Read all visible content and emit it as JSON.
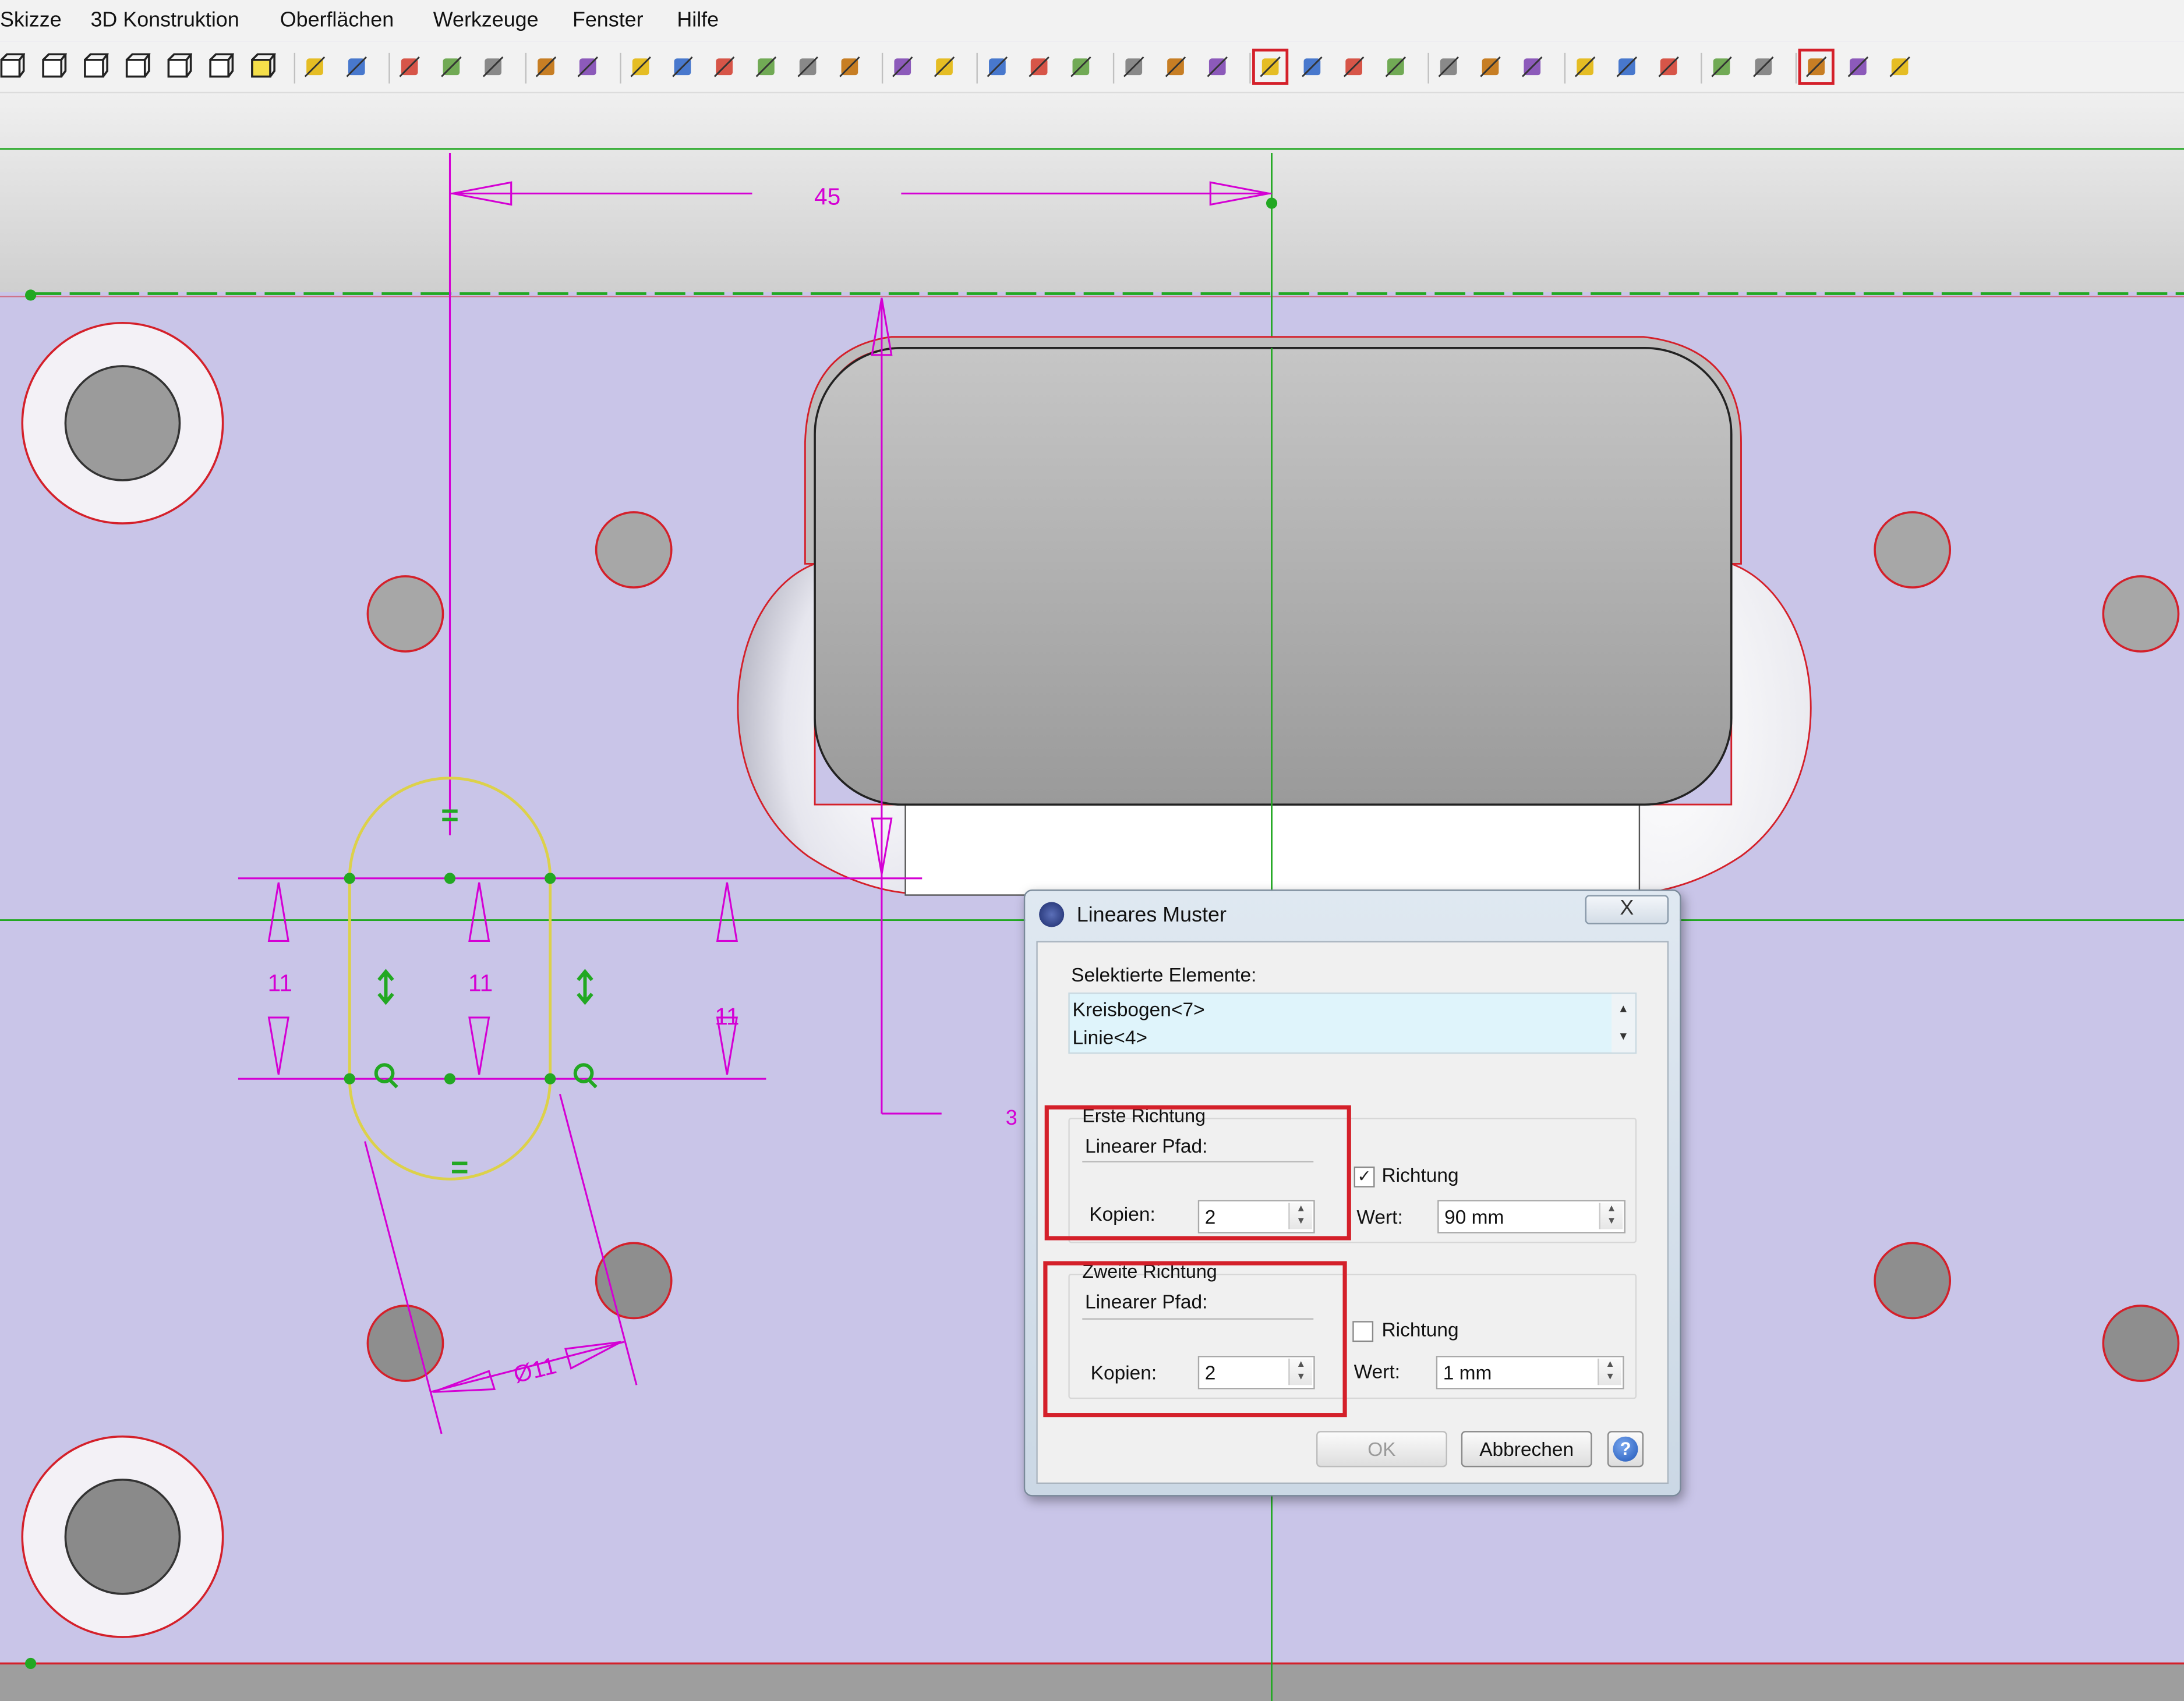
{
  "menu": [
    "Skizze",
    "3D Konstruktion",
    "Oberflächen",
    "Werkzeuge",
    "Fenster",
    "Hilfe"
  ],
  "toolbar_icons": [
    "view-front-icon",
    "view-back-icon",
    "view-left-icon",
    "view-right-icon",
    "view-top-icon",
    "view-bottom-icon",
    "view-iso-icon",
    "undo-icon",
    "redo-icon",
    "layers-icon",
    "render-icon",
    "shade-icon",
    "rotate-icon",
    "material-icon",
    "sketch-icon",
    "star-icon",
    "point-icon",
    "measure-icon",
    "calc-icon",
    "bucket-icon",
    "ruler-icon",
    "balance-icon",
    "dim-icon",
    "dim-h-icon",
    "dim-v-icon",
    "part-icon",
    "profile-icon",
    "profile-edit-icon",
    "sketch-edit-icon",
    "grid-icon",
    "grid-2-icon",
    "trim-icon",
    "select-icon",
    "move-icon",
    "rotate-view-icon",
    "zoom-in-icon",
    "zoom-window-icon",
    "zoom-out-icon",
    "back-icon",
    "forward-icon",
    "cube-solid-icon",
    "cube-wire-icon",
    "box-render-icon"
  ],
  "drawing": {
    "dim_top": "45",
    "dim_left": "11",
    "dim_mid": "11",
    "dim_right": "11",
    "dim_diameter": "Ø11",
    "dim_partial": "3",
    "constraint_equal": "="
  },
  "dialog": {
    "title": "Lineares Muster",
    "close": "X",
    "selected_label": "Selektierte Elemente:",
    "selected_items": [
      "Kreisbogen<7>",
      "Linie<4>"
    ],
    "first": {
      "group": "Erste Richtung",
      "path_label": "Linearer Pfad:",
      "copies_label": "Kopien:",
      "copies": "2",
      "direction_label": "Richtung",
      "direction_checked": true,
      "value_label": "Wert:",
      "value": "90 mm"
    },
    "second": {
      "group": "Zweite Richtung",
      "path_label": "Linearer Pfad:",
      "copies_label": "Kopien:",
      "copies": "2",
      "direction_label": "Richtung",
      "direction_checked": false,
      "value_label": "Wert:",
      "value": "1 mm"
    },
    "ok": "OK",
    "cancel": "Abbrechen",
    "help": "?"
  },
  "colors": {
    "plate": "#c9c5e8",
    "sketch": "#d400d4",
    "construction": "#22a822",
    "highlight": "#d4202a"
  }
}
